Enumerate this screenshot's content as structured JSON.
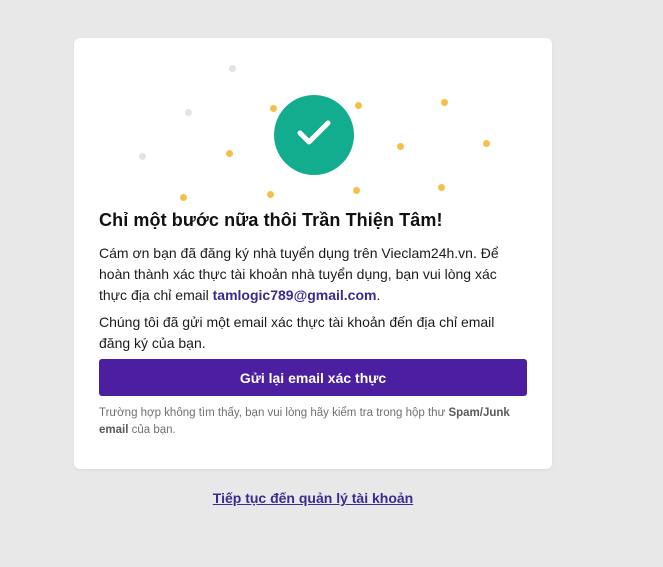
{
  "card": {
    "title": "Chỉ một bước nữa thôi Trần Thiện Tâm!",
    "message_prefix": "Cám ơn bạn đã đăng ký nhà tuyển dụng trên Vieclam24h.vn. Để hoàn thành xác thực tài khoản nhà tuyển dụng, bạn vui lòng xác thực địa chỉ email ",
    "email": "tamlogic789@gmail.com",
    "message_suffix": ".",
    "sent_notice": "Chúng tôi đã gửi một email xác thực tài khoản đến địa chỉ email đăng ký của bạn.",
    "resend_button_label": "Gửi lại email xác thực",
    "note_prefix": "Trường hợp không tìm thấy, bạn vui lòng hãy kiểm tra trong hộp thư ",
    "note_bold": "Spam/Junk email",
    "note_suffix": " của bạn.",
    "success_icon": "check-icon"
  },
  "continue_link_label": "Tiếp tục đến quản lý tài khoản",
  "colors": {
    "background": "#e8e8e8",
    "check_circle": "#12ad8e",
    "primary_button": "#4b1fa0",
    "link": "#3d2a8c",
    "confetti_yellow": "#f5c04a",
    "confetti_gray": "#e3e3e3"
  }
}
